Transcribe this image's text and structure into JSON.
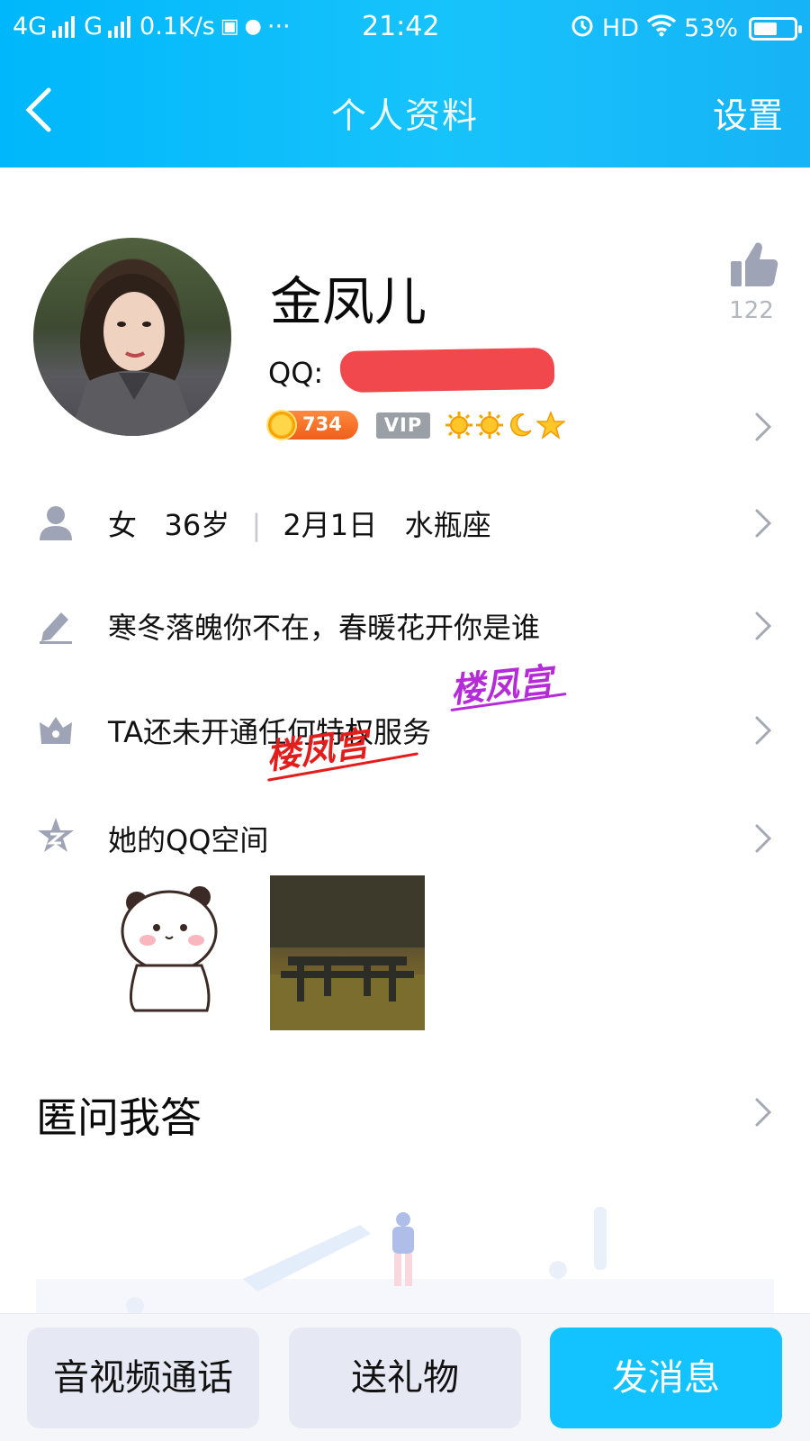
{
  "status_bar": {
    "network1": "4G",
    "network2": "G",
    "speed": "0.1K/s",
    "more": "···",
    "time": "21:42",
    "hd": "HD",
    "battery": "53%"
  },
  "nav": {
    "title": "个人资料",
    "settings": "设置"
  },
  "profile": {
    "name": "金凤儿",
    "qq_label": "QQ:",
    "level": "734",
    "vip": "VIP",
    "likes": "122"
  },
  "rows": {
    "basic": {
      "gender": "女",
      "age": "36岁",
      "separator": "|",
      "birthday": "2月1日",
      "zodiac": "水瓶座"
    },
    "signature": "寒冬落魄你不在，春暖花开你是谁",
    "privilege": "TA还未开通任何特权服务",
    "qzone": "她的QQ空间"
  },
  "watermarks": [
    "楼凤宫",
    "楼凤宫"
  ],
  "qa": {
    "title": "匿问我答"
  },
  "actions": {
    "call": "音视频通话",
    "gift": "送礼物",
    "message": "发消息"
  },
  "colors": {
    "header": "#12c3fb",
    "primary_button": "#12c3ff",
    "secondary_button": "#e6e8f3",
    "icon_gray": "#9ea3b5"
  },
  "icons": [
    "back-arrow-icon",
    "alarm-icon",
    "wifi-icon",
    "battery-icon",
    "thumbs-up-icon",
    "person-icon",
    "pencil-icon",
    "crown-icon",
    "qzone-star-icon",
    "chevron-right-icon"
  ]
}
